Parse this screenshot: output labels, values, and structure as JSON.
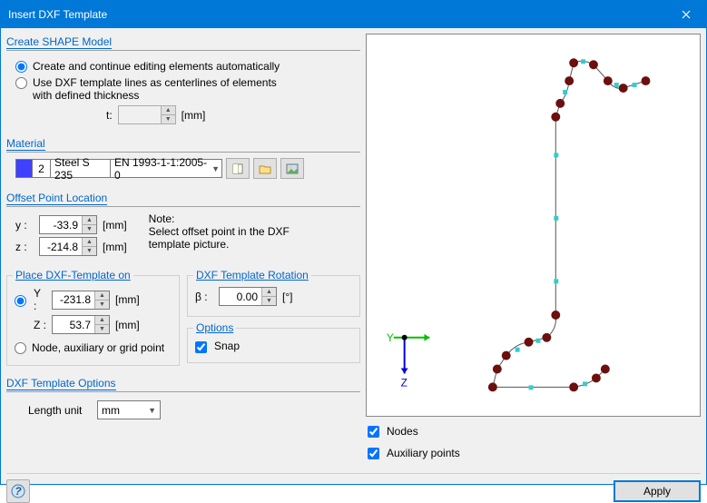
{
  "window": {
    "title": "Insert DXF Template"
  },
  "shape": {
    "header": "Create SHAPE Model",
    "radio1": "Create and continue editing elements automatically",
    "radio2": "Use DXF template lines as centerlines of elements with defined thickness",
    "t_label": "t:",
    "t_value": "",
    "t_unit": "[mm]"
  },
  "material": {
    "header": "Material",
    "num": "2",
    "name": "Steel S 235",
    "standard": "EN 1993-1-1:2005-0"
  },
  "offset": {
    "header": "Offset Point Location",
    "y_label": "y :",
    "y_value": "-33.9",
    "z_label": "z :",
    "z_value": "-214.8",
    "unit": "[mm]",
    "note_title": "Note:",
    "note_body": "Select offset point in the DXF template picture."
  },
  "place": {
    "header": "Place DXF-Template on",
    "y_label": "Y :",
    "y_value": "-231.8",
    "z_label": "Z :",
    "z_value": "53.7",
    "unit": "[mm]",
    "node_radio": "Node, auxiliary or grid point"
  },
  "rotation": {
    "header": "DXF Template Rotation",
    "beta_label": "β :",
    "beta_value": "0.00",
    "beta_unit": "[°]"
  },
  "options": {
    "header": "Options",
    "snap": "Snap"
  },
  "tmpl_options": {
    "header": "DXF Template Options",
    "length_unit_label": "Length unit",
    "length_unit_value": "mm"
  },
  "preview": {
    "axis_y": "Y",
    "axis_z": "Z",
    "nodes_check": "Nodes",
    "aux_check": "Auxiliary points"
  },
  "footer": {
    "apply": "Apply"
  }
}
